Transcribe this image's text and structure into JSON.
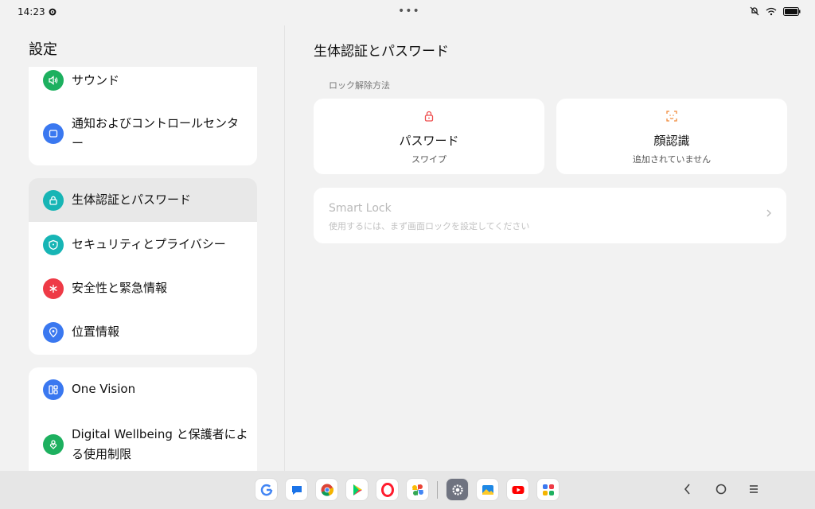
{
  "status": {
    "time": "14:23"
  },
  "left": {
    "title": "設定",
    "items": [
      {
        "label": "サウンド",
        "icon": "speaker-icon",
        "color": "#1db05f"
      },
      {
        "label": "通知およびコントロールセンター",
        "icon": "notification-panel-icon",
        "color": "#3a78f0"
      },
      {
        "label": "生体認証とパスワード",
        "icon": "lock-icon",
        "color": "#17b5b5"
      },
      {
        "label": "セキュリティとプライバシー",
        "icon": "shield-icon",
        "color": "#17b5b5"
      },
      {
        "label": "安全性と緊急情報",
        "icon": "asterisk-icon",
        "color": "#ee3a46"
      },
      {
        "label": "位置情報",
        "icon": "location-pin-icon",
        "color": "#3a78f0"
      },
      {
        "label": "One Vision",
        "icon": "split-screen-icon",
        "color": "#3a78f0"
      },
      {
        "label": "Digital Wellbeing と保護者による使用制限",
        "icon": "wellbeing-icon",
        "color": "#1db05f"
      }
    ]
  },
  "right": {
    "title": "生体認証とパスワード",
    "section_label": "ロック解除方法",
    "tiles": [
      {
        "name": "パスワード",
        "sub": "スワイプ",
        "icon": "lock-icon",
        "color": "#ee4a4a"
      },
      {
        "name": "顔認識",
        "sub": "追加されていません",
        "icon": "face-scan-icon",
        "color": "#f08a3a"
      }
    ],
    "smart_lock": {
      "title": "Smart Lock",
      "sub": "使用するには、まず画面ロックを設定してください"
    }
  },
  "dock_apps": [
    "google-icon",
    "messages-icon",
    "chrome-icon",
    "play-store-icon",
    "opera-icon",
    "photos-icon",
    "settings-icon",
    "gallery-icon",
    "youtube-icon",
    "app-drawer-icon"
  ]
}
